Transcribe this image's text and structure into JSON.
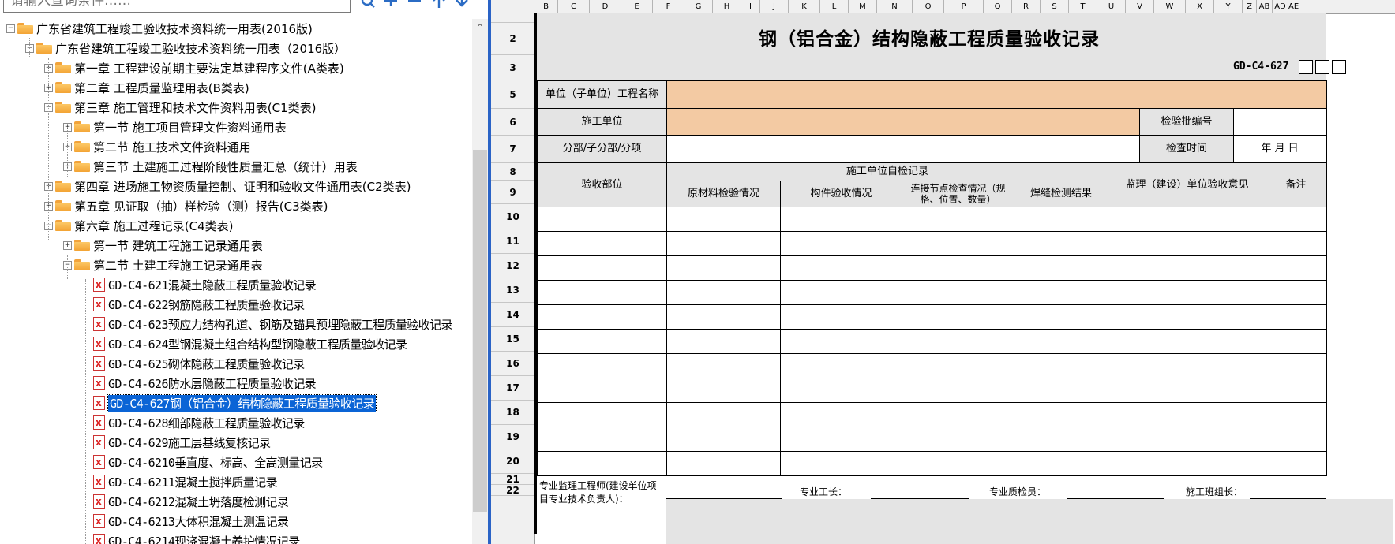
{
  "search": {
    "placeholder": "请输入查询条件……"
  },
  "toolbar": {
    "search_icon": "search-icon",
    "add_icon": "plus-icon",
    "remove_icon": "minus-icon",
    "up_icon": "arrow-up-icon",
    "down_icon": "arrow-down-icon"
  },
  "tree": {
    "root": "广东省建筑工程竣工验收技术资料统一用表(2016版)",
    "child": "广东省建筑工程竣工验收技术资料统一用表（2016版）",
    "chapters": [
      "第一章 工程建设前期主要法定基建程序文件(A类表)",
      "第二章 工程质量监理用表(B类表)",
      "第三章 施工管理和技术文件资料用表(C1类表)",
      "第四章 进场施工物资质量控制、证明和验收文件通用表(C2类表)",
      "第五章  见证取（抽）样检验（测）报告(C3类表)",
      "第六章 施工过程记录(C4类表)"
    ],
    "ch3_sections": [
      "第一节 施工项目管理文件资料通用表",
      "第二节 施工技术文件资料通用",
      "第三节 土建施工过程阶段性质量汇总（统计）用表"
    ],
    "ch6_sections": [
      "第一节 建筑工程施工记录通用表",
      "第二节 土建工程施工记录通用表"
    ],
    "documents": [
      "GD-C4-621混凝土隐蔽工程质量验收记录",
      "GD-C4-622钢筋隐蔽工程质量验收记录",
      "GD-C4-623预应力结构孔道、钢筋及锚具预埋隐蔽工程质量验收记录",
      "GD-C4-624型钢混凝土组合结构型钢隐蔽工程质量验收记录",
      "GD-C4-625砌体隐蔽工程质量验收记录",
      "GD-C4-626防水层隐蔽工程质量验收记录",
      "GD-C4-627钢（铝合金）结构隐蔽工程质量验收记录",
      "GD-C4-628细部隐蔽工程质量验收记录",
      "GD-C4-629施工层基线复核记录",
      "GD-C4-6210垂直度、标高、全高测量记录",
      "GD-C4-6211混凝土搅拌质量记录",
      "GD-C4-6212混凝土坍落度检测记录",
      "GD-C4-6213大体积混凝土测温记录",
      "GD-C4-6214现浇混凝土养护情况记录"
    ],
    "selected_index": 6
  },
  "sheet": {
    "columns": [
      "B",
      "C",
      "D",
      "E",
      "F",
      "G",
      "H",
      "I",
      "J",
      "K",
      "L",
      "M",
      "N",
      "O",
      "P",
      "Q",
      "R",
      "S",
      "T",
      "U",
      "V",
      "W",
      "X",
      "Y",
      "Z",
      "AB",
      "AD",
      "AE"
    ],
    "rows": [
      "2",
      "3",
      "5",
      "6",
      "7",
      "8",
      "9",
      "10",
      "11",
      "12",
      "13",
      "14",
      "15",
      "16",
      "17",
      "18",
      "19",
      "20",
      "21",
      "22"
    ],
    "title": "钢（铝合金）结构隐蔽工程质量验收记录",
    "code": "GD-C4-627",
    "labels": {
      "project_name": "单位（子单位）工程名称",
      "contractor": "施工单位",
      "batch_no": "检验批编号",
      "division": "分部/子分部/分项",
      "check_time": "检查时间",
      "date_placeholder": "年  月  日",
      "inspection_part": "验收部位",
      "self_check": "施工单位自检记录",
      "raw_material": "原材料检验情况",
      "component": "构件验收情况",
      "connection": "连接节点检查情况（规格、位置、数量）",
      "weld": "焊缝检测结果",
      "supervisor_opinion": "监理（建设）单位验收意见",
      "remarks": "备注",
      "supervisor_sign": "专业监理工程师(建设单位项目专业技术负责人)：",
      "foreman": "专业工长：",
      "inspector": "专业质检员：",
      "team_leader": "施工班组长："
    }
  }
}
